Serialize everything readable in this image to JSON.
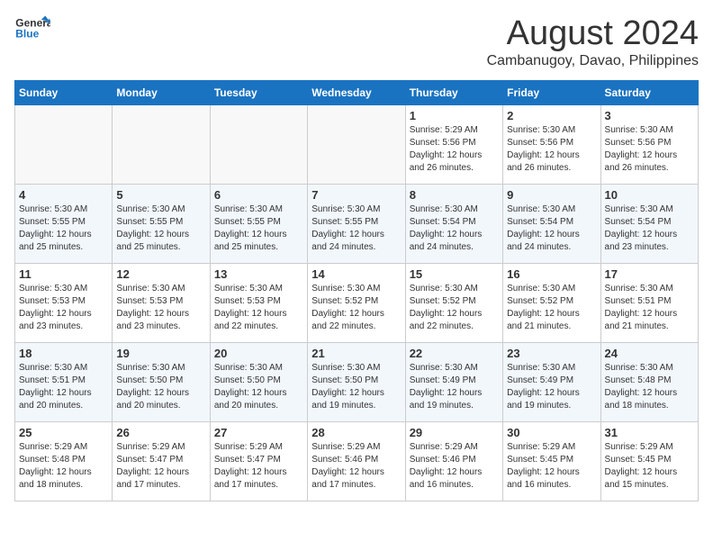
{
  "header": {
    "logo_general": "General",
    "logo_blue": "Blue",
    "month_year": "August 2024",
    "location": "Cambanugoy, Davao, Philippines"
  },
  "days_of_week": [
    "Sunday",
    "Monday",
    "Tuesday",
    "Wednesday",
    "Thursday",
    "Friday",
    "Saturday"
  ],
  "weeks": [
    [
      {
        "day": "",
        "sunrise": "",
        "sunset": "",
        "daylight": ""
      },
      {
        "day": "",
        "sunrise": "",
        "sunset": "",
        "daylight": ""
      },
      {
        "day": "",
        "sunrise": "",
        "sunset": "",
        "daylight": ""
      },
      {
        "day": "",
        "sunrise": "",
        "sunset": "",
        "daylight": ""
      },
      {
        "day": "1",
        "sunrise": "Sunrise: 5:29 AM",
        "sunset": "Sunset: 5:56 PM",
        "daylight": "Daylight: 12 hours and 26 minutes."
      },
      {
        "day": "2",
        "sunrise": "Sunrise: 5:30 AM",
        "sunset": "Sunset: 5:56 PM",
        "daylight": "Daylight: 12 hours and 26 minutes."
      },
      {
        "day": "3",
        "sunrise": "Sunrise: 5:30 AM",
        "sunset": "Sunset: 5:56 PM",
        "daylight": "Daylight: 12 hours and 26 minutes."
      }
    ],
    [
      {
        "day": "4",
        "sunrise": "Sunrise: 5:30 AM",
        "sunset": "Sunset: 5:55 PM",
        "daylight": "Daylight: 12 hours and 25 minutes."
      },
      {
        "day": "5",
        "sunrise": "Sunrise: 5:30 AM",
        "sunset": "Sunset: 5:55 PM",
        "daylight": "Daylight: 12 hours and 25 minutes."
      },
      {
        "day": "6",
        "sunrise": "Sunrise: 5:30 AM",
        "sunset": "Sunset: 5:55 PM",
        "daylight": "Daylight: 12 hours and 25 minutes."
      },
      {
        "day": "7",
        "sunrise": "Sunrise: 5:30 AM",
        "sunset": "Sunset: 5:55 PM",
        "daylight": "Daylight: 12 hours and 24 minutes."
      },
      {
        "day": "8",
        "sunrise": "Sunrise: 5:30 AM",
        "sunset": "Sunset: 5:54 PM",
        "daylight": "Daylight: 12 hours and 24 minutes."
      },
      {
        "day": "9",
        "sunrise": "Sunrise: 5:30 AM",
        "sunset": "Sunset: 5:54 PM",
        "daylight": "Daylight: 12 hours and 24 minutes."
      },
      {
        "day": "10",
        "sunrise": "Sunrise: 5:30 AM",
        "sunset": "Sunset: 5:54 PM",
        "daylight": "Daylight: 12 hours and 23 minutes."
      }
    ],
    [
      {
        "day": "11",
        "sunrise": "Sunrise: 5:30 AM",
        "sunset": "Sunset: 5:53 PM",
        "daylight": "Daylight: 12 hours and 23 minutes."
      },
      {
        "day": "12",
        "sunrise": "Sunrise: 5:30 AM",
        "sunset": "Sunset: 5:53 PM",
        "daylight": "Daylight: 12 hours and 23 minutes."
      },
      {
        "day": "13",
        "sunrise": "Sunrise: 5:30 AM",
        "sunset": "Sunset: 5:53 PM",
        "daylight": "Daylight: 12 hours and 22 minutes."
      },
      {
        "day": "14",
        "sunrise": "Sunrise: 5:30 AM",
        "sunset": "Sunset: 5:52 PM",
        "daylight": "Daylight: 12 hours and 22 minutes."
      },
      {
        "day": "15",
        "sunrise": "Sunrise: 5:30 AM",
        "sunset": "Sunset: 5:52 PM",
        "daylight": "Daylight: 12 hours and 22 minutes."
      },
      {
        "day": "16",
        "sunrise": "Sunrise: 5:30 AM",
        "sunset": "Sunset: 5:52 PM",
        "daylight": "Daylight: 12 hours and 21 minutes."
      },
      {
        "day": "17",
        "sunrise": "Sunrise: 5:30 AM",
        "sunset": "Sunset: 5:51 PM",
        "daylight": "Daylight: 12 hours and 21 minutes."
      }
    ],
    [
      {
        "day": "18",
        "sunrise": "Sunrise: 5:30 AM",
        "sunset": "Sunset: 5:51 PM",
        "daylight": "Daylight: 12 hours and 20 minutes."
      },
      {
        "day": "19",
        "sunrise": "Sunrise: 5:30 AM",
        "sunset": "Sunset: 5:50 PM",
        "daylight": "Daylight: 12 hours and 20 minutes."
      },
      {
        "day": "20",
        "sunrise": "Sunrise: 5:30 AM",
        "sunset": "Sunset: 5:50 PM",
        "daylight": "Daylight: 12 hours and 20 minutes."
      },
      {
        "day": "21",
        "sunrise": "Sunrise: 5:30 AM",
        "sunset": "Sunset: 5:50 PM",
        "daylight": "Daylight: 12 hours and 19 minutes."
      },
      {
        "day": "22",
        "sunrise": "Sunrise: 5:30 AM",
        "sunset": "Sunset: 5:49 PM",
        "daylight": "Daylight: 12 hours and 19 minutes."
      },
      {
        "day": "23",
        "sunrise": "Sunrise: 5:30 AM",
        "sunset": "Sunset: 5:49 PM",
        "daylight": "Daylight: 12 hours and 19 minutes."
      },
      {
        "day": "24",
        "sunrise": "Sunrise: 5:30 AM",
        "sunset": "Sunset: 5:48 PM",
        "daylight": "Daylight: 12 hours and 18 minutes."
      }
    ],
    [
      {
        "day": "25",
        "sunrise": "Sunrise: 5:29 AM",
        "sunset": "Sunset: 5:48 PM",
        "daylight": "Daylight: 12 hours and 18 minutes."
      },
      {
        "day": "26",
        "sunrise": "Sunrise: 5:29 AM",
        "sunset": "Sunset: 5:47 PM",
        "daylight": "Daylight: 12 hours and 17 minutes."
      },
      {
        "day": "27",
        "sunrise": "Sunrise: 5:29 AM",
        "sunset": "Sunset: 5:47 PM",
        "daylight": "Daylight: 12 hours and 17 minutes."
      },
      {
        "day": "28",
        "sunrise": "Sunrise: 5:29 AM",
        "sunset": "Sunset: 5:46 PM",
        "daylight": "Daylight: 12 hours and 17 minutes."
      },
      {
        "day": "29",
        "sunrise": "Sunrise: 5:29 AM",
        "sunset": "Sunset: 5:46 PM",
        "daylight": "Daylight: 12 hours and 16 minutes."
      },
      {
        "day": "30",
        "sunrise": "Sunrise: 5:29 AM",
        "sunset": "Sunset: 5:45 PM",
        "daylight": "Daylight: 12 hours and 16 minutes."
      },
      {
        "day": "31",
        "sunrise": "Sunrise: 5:29 AM",
        "sunset": "Sunset: 5:45 PM",
        "daylight": "Daylight: 12 hours and 15 minutes."
      }
    ]
  ]
}
